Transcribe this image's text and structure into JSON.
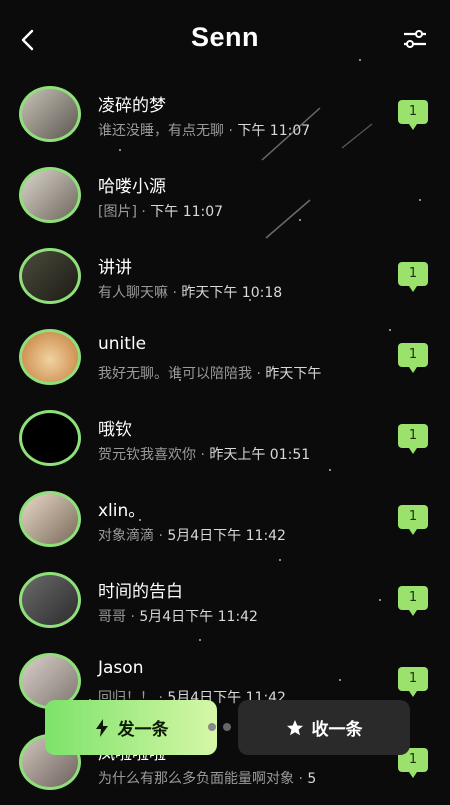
{
  "header": {
    "title": "Senn",
    "back_icon": "chevron-left-icon",
    "filter_icon": "sliders-icon"
  },
  "accent_color": "#9be26d",
  "chats": [
    {
      "name": "凌碎的梦",
      "preview": "谁还没睡，有点无聊",
      "time": "下午 11:07",
      "unread": "1"
    },
    {
      "name": "哈喽小源",
      "preview": "[图片]",
      "time": "下午 11:07",
      "unread": ""
    },
    {
      "name": "讲讲",
      "preview": "有人聊天嘛",
      "time": "昨天下午 10:18",
      "unread": "1"
    },
    {
      "name": "unitle",
      "preview": "我好无聊。谁可以陪陪我",
      "time": "昨天下午",
      "unread": "1"
    },
    {
      "name": "哦钦",
      "preview": "贺元钦我喜欢你",
      "time": "昨天上午 01:51",
      "unread": "1"
    },
    {
      "name": "xlin。",
      "preview": "对象滴滴",
      "time": "5月4日下午 11:42",
      "unread": "1"
    },
    {
      "name": "时间的告白",
      "preview": "哥哥",
      "time": "5月4日下午 11:42",
      "unread": "1"
    },
    {
      "name": "Jason",
      "preview": "回归！！",
      "time": "5月4日下午 11:42",
      "unread": "1"
    },
    {
      "name": "凤啦啦啦",
      "preview": "为什么有那么多负面能量啊对象",
      "time": "5",
      "unread": "1"
    }
  ],
  "actions": {
    "send_label": "发一条",
    "send_icon": "bolt-icon",
    "receive_label": "收一条",
    "receive_icon": "star-icon"
  }
}
